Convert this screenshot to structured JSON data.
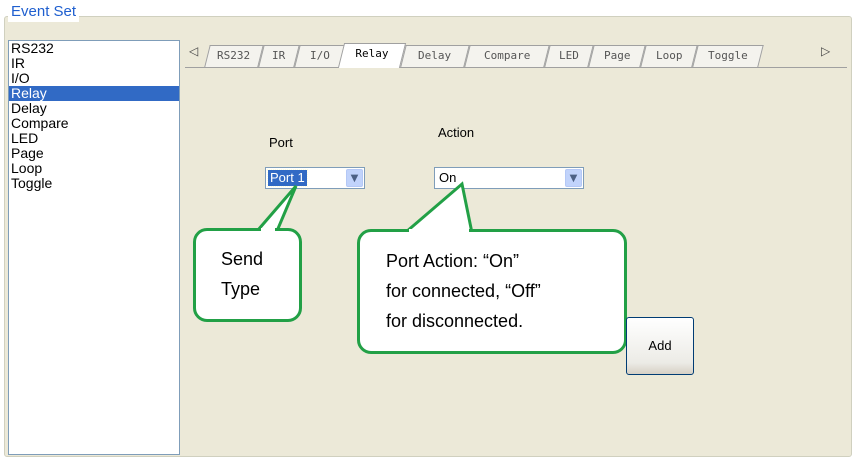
{
  "group": {
    "title": "Event Set"
  },
  "event_list": [
    {
      "label": "RS232",
      "selected": false
    },
    {
      "label": "IR",
      "selected": false
    },
    {
      "label": "I/O",
      "selected": false
    },
    {
      "label": "Relay",
      "selected": true
    },
    {
      "label": "Delay",
      "selected": false
    },
    {
      "label": "Compare",
      "selected": false
    },
    {
      "label": "LED",
      "selected": false
    },
    {
      "label": "Page",
      "selected": false
    },
    {
      "label": "Loop",
      "selected": false
    },
    {
      "label": "Toggle",
      "selected": false
    }
  ],
  "tabs": [
    {
      "label": "RS232"
    },
    {
      "label": "IR"
    },
    {
      "label": "I/O"
    },
    {
      "label": "Relay"
    },
    {
      "label": "Delay"
    },
    {
      "label": "Compare"
    },
    {
      "label": "LED"
    },
    {
      "label": "Page"
    },
    {
      "label": "Loop"
    },
    {
      "label": "Toggle"
    }
  ],
  "active_tab": "Relay",
  "port": {
    "label": "Port",
    "value": "Port 1"
  },
  "action": {
    "label": "Action",
    "value": "On"
  },
  "add_button": {
    "label": "Add"
  },
  "callouts": {
    "send_type": [
      "Send",
      "Type"
    ],
    "port_action": [
      "Port Action: “On”",
      "for connected, “Off”",
      "for disconnected."
    ]
  },
  "colors": {
    "callout_border": "#22a046",
    "selection": "#316ac5",
    "title": "#1f5fcf"
  }
}
